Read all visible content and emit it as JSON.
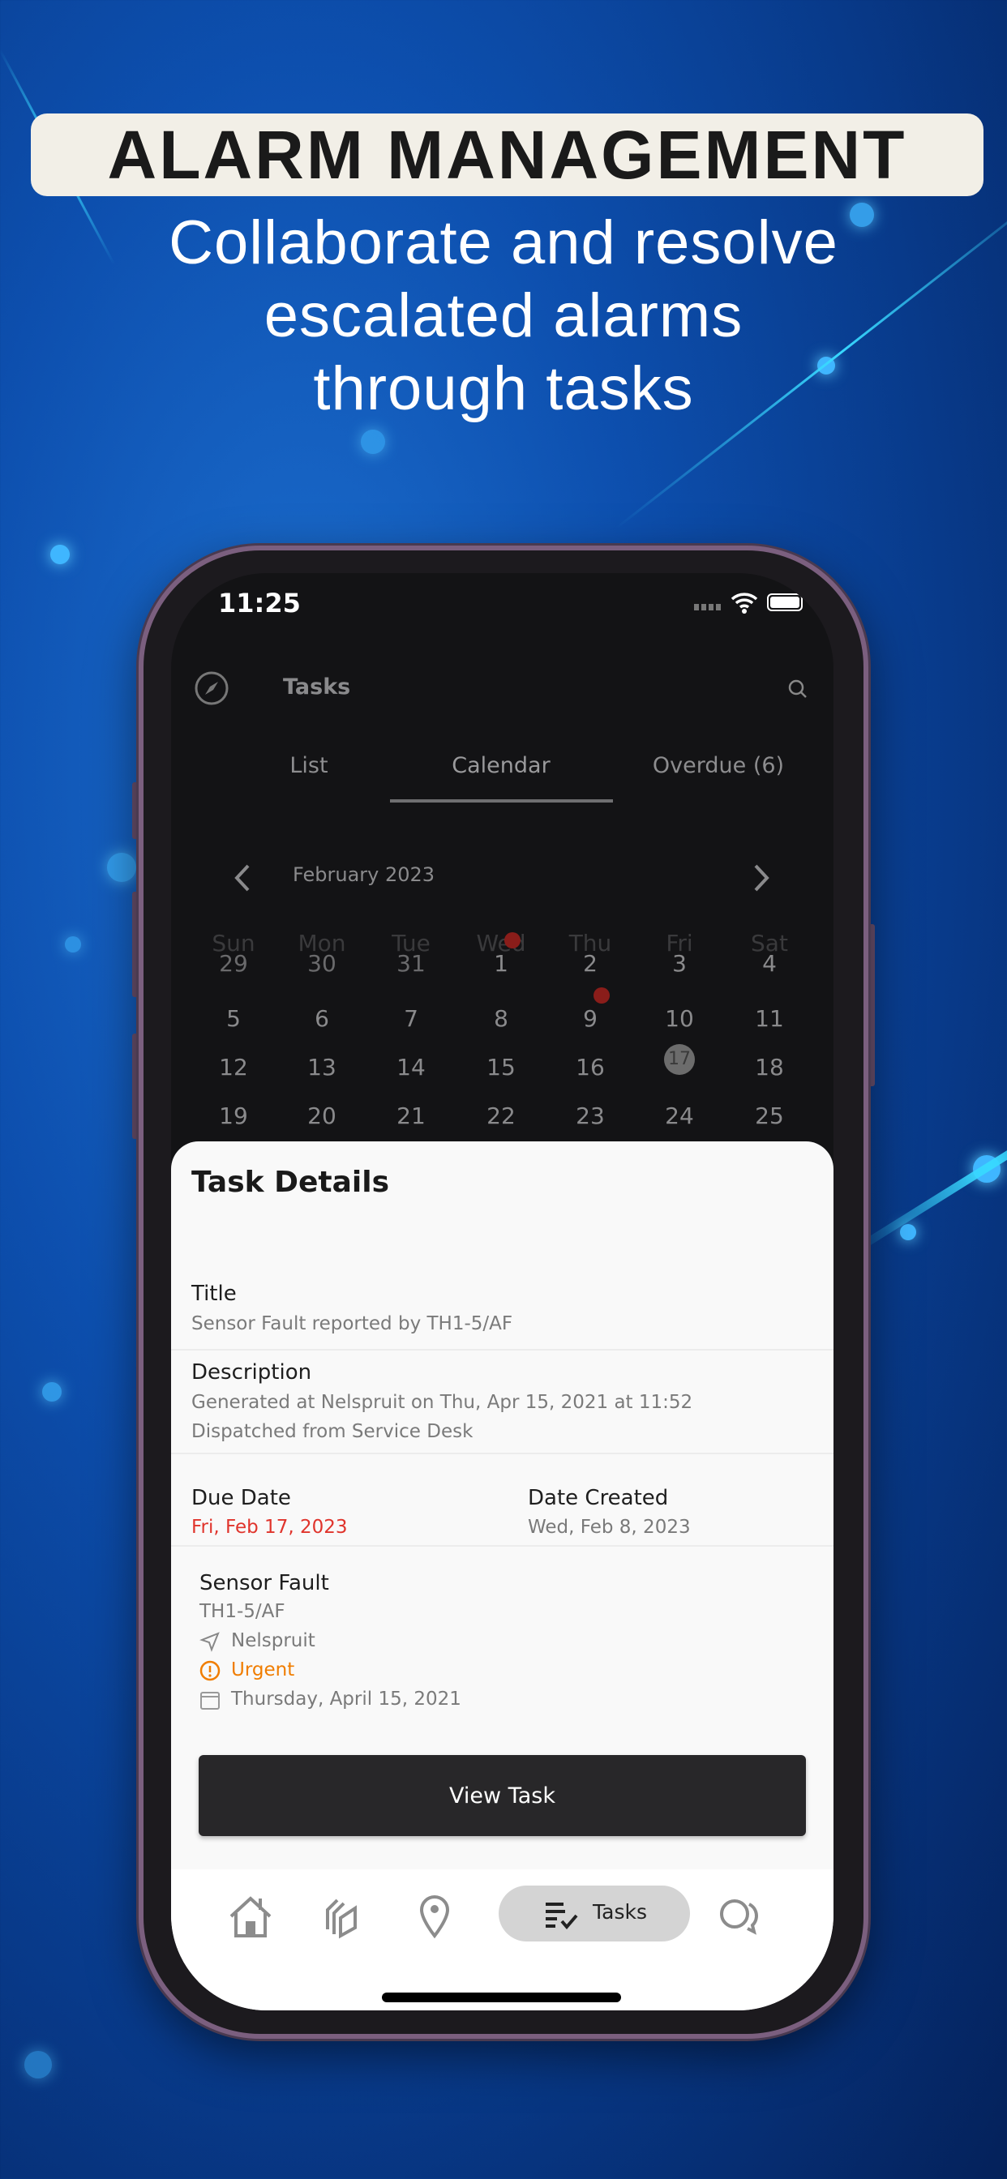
{
  "banner": {
    "title": "ALARM MANAGEMENT",
    "subtitle_lines": [
      "Collaborate and resolve",
      "escalated alarms",
      "through tasks"
    ]
  },
  "status_bar": {
    "time": "11:25"
  },
  "header": {
    "title": "Tasks",
    "left_icon": "compass-icon",
    "right_icon": "search-icon"
  },
  "tabs": [
    {
      "label": "List"
    },
    {
      "label": "Calendar",
      "active": true
    },
    {
      "label": "Overdue (6)"
    }
  ],
  "calendar": {
    "month": "February 2023",
    "weekdays": [
      "Sun",
      "Mon",
      "Tue",
      "Wed",
      "Thu",
      "Fri",
      "Sat"
    ],
    "rows": [
      [
        "29",
        "30",
        "31",
        "1",
        "2",
        "3",
        "4"
      ],
      [
        "5",
        "6",
        "7",
        "8",
        "9",
        "10",
        "11"
      ],
      [
        "12",
        "13",
        "14",
        "15",
        "16",
        "17",
        "18"
      ],
      [
        "19",
        "20",
        "21",
        "22",
        "23",
        "24",
        "25"
      ]
    ],
    "selected": "17",
    "event_days": [
      "1",
      "9"
    ],
    "event_color": "#8a1d1a"
  },
  "task_details": {
    "heading": "Task Details",
    "title_label": "Title",
    "title_value": "Sensor Fault reported by TH1-5/AF",
    "description_label": "Description",
    "description_lines": [
      "Generated at Nelspruit on Thu, Apr 15, 2021 at 11:52",
      "Dispatched from Service Desk"
    ],
    "due_label": "Due Date",
    "due_value": "Fri, Feb 17, 2023",
    "due_color": "#e0342c",
    "created_label": "Date Created",
    "created_value": "Wed, Feb 8, 2023",
    "alarm": {
      "name": "Sensor Fault",
      "code": "TH1-5/AF",
      "location": "Nelspruit",
      "priority": "Urgent",
      "priority_color": "#f07d00",
      "date": "Thursday, April 15, 2021"
    },
    "button": "View Task"
  },
  "bottom_nav": [
    {
      "icon": "home-icon"
    },
    {
      "icon": "layers-icon"
    },
    {
      "icon": "location-pin-icon"
    },
    {
      "icon": "tasks-icon",
      "label": "Tasks",
      "active": true
    },
    {
      "icon": "chat-icon"
    }
  ]
}
